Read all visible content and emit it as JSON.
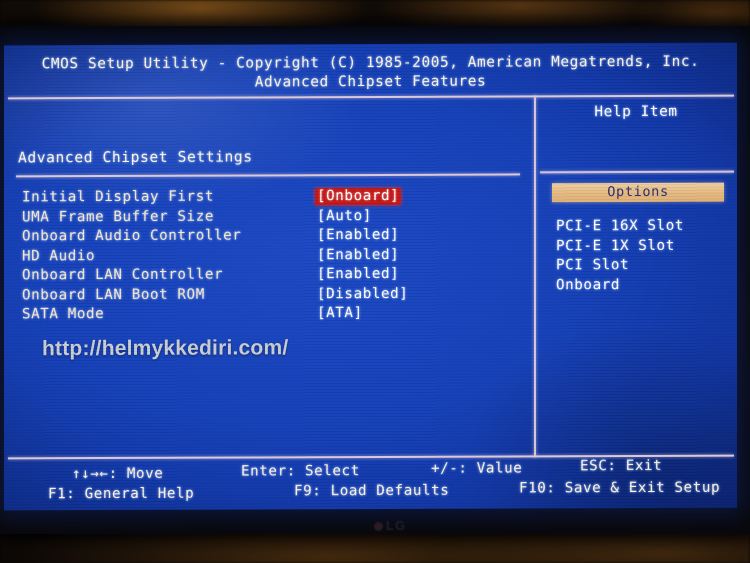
{
  "photo": {
    "monitor_brand": "LG"
  },
  "header": {
    "title": "CMOS Setup Utility - Copyright (C) 1985-2005, American Megatrends, Inc.",
    "subtitle": "Advanced Chipset Features"
  },
  "main": {
    "section_title": "Advanced Chipset Settings",
    "settings": [
      {
        "label": "Initial Display First",
        "value": "[Onboard]",
        "selected": true
      },
      {
        "label": "UMA Frame Buffer Size",
        "value": "[Auto]",
        "selected": false
      },
      {
        "label": "Onboard Audio Controller",
        "value": "[Enabled]",
        "selected": false
      },
      {
        "label": "HD Audio",
        "value": "[Enabled]",
        "selected": false
      },
      {
        "label": "Onboard LAN Controller",
        "value": "[Enabled]",
        "selected": false
      },
      {
        "label": "Onboard LAN Boot ROM",
        "value": "[Disabled]",
        "selected": false
      },
      {
        "label": "SATA Mode",
        "value": "[ATA]",
        "selected": false
      }
    ]
  },
  "watermark": {
    "text": "http://helmykkediri.com/"
  },
  "help": {
    "title": "Help Item",
    "options_label": "Options",
    "options": [
      "PCI-E 16X Slot",
      "PCI-E 1X Slot",
      "PCI Slot",
      "Onboard"
    ]
  },
  "footer": {
    "move": "↑↓→←: Move",
    "enter": "Enter: Select",
    "value": "+/-: Value",
    "esc": "ESC: Exit",
    "f1": "F1: General Help",
    "f9": "F9: Load Defaults",
    "f10": "F10: Save & Exit Setup"
  },
  "colors": {
    "screen_blue": "#1540b8",
    "selected_red": "#c61616",
    "options_bar": "#e6bb82",
    "rule": "#d9c8d8",
    "label_cream": "#f7e9cf"
  }
}
